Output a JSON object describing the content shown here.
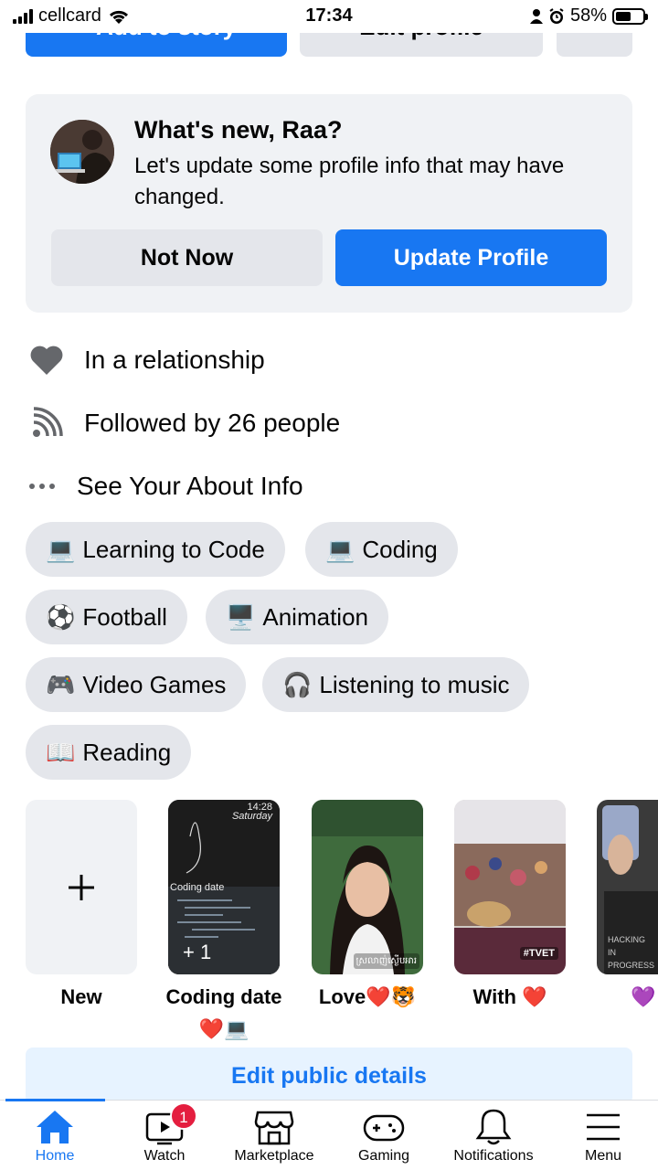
{
  "status_bar": {
    "carrier": "cellcard",
    "time": "17:34",
    "battery": "58%",
    "battery_level": 0.58
  },
  "top_buttons": {
    "add_story": "+ Add to story",
    "edit_profile": "Edit profile"
  },
  "whats_new": {
    "title": "What's new, Raa?",
    "text": "Let's update some profile info that may have changed.",
    "not_now": "Not Now",
    "update_profile": "Update Profile"
  },
  "info": {
    "relationship": "In a relationship",
    "followers": "Followed by 26 people",
    "see_about": "See Your About Info"
  },
  "interests": [
    {
      "emoji": "💻",
      "label": "Learning to Code"
    },
    {
      "emoji": "💻",
      "label": "Coding"
    },
    {
      "emoji": "⚽",
      "label": "Football"
    },
    {
      "emoji": "🖥️",
      "label": "Animation"
    },
    {
      "emoji": "🎮",
      "label": "Video Games"
    },
    {
      "emoji": "🎧",
      "label": "Listening to music"
    },
    {
      "emoji": "📖",
      "label": "Reading"
    }
  ],
  "highlights": {
    "new_label": "New",
    "items": [
      {
        "label": "Coding date❤️💻",
        "overlay": "+ 1",
        "clock": "14:28",
        "day": "Saturday",
        "caption": "Coding date"
      },
      {
        "label": "Love❤️🐯",
        "caption": "ស្រលាញ់ស្ងើបអារ"
      },
      {
        "label": "With ❤️",
        "caption": "#TVET"
      },
      {
        "label": "💜",
        "caption": "HACKING IN PROGRESS"
      }
    ]
  },
  "edit_public_details": "Edit public details",
  "tabs": [
    {
      "label": "Home",
      "icon": "home-icon",
      "active": true
    },
    {
      "label": "Watch",
      "icon": "watch-icon",
      "badge": "1"
    },
    {
      "label": "Marketplace",
      "icon": "marketplace-icon"
    },
    {
      "label": "Gaming",
      "icon": "gaming-icon"
    },
    {
      "label": "Notifications",
      "icon": "bell-icon"
    },
    {
      "label": "Menu",
      "icon": "menu-icon"
    }
  ],
  "colors": {
    "accent": "#1877f2",
    "chip_bg": "#e4e6eb",
    "card_bg": "#f0f2f5",
    "badge": "#e41e3f"
  }
}
